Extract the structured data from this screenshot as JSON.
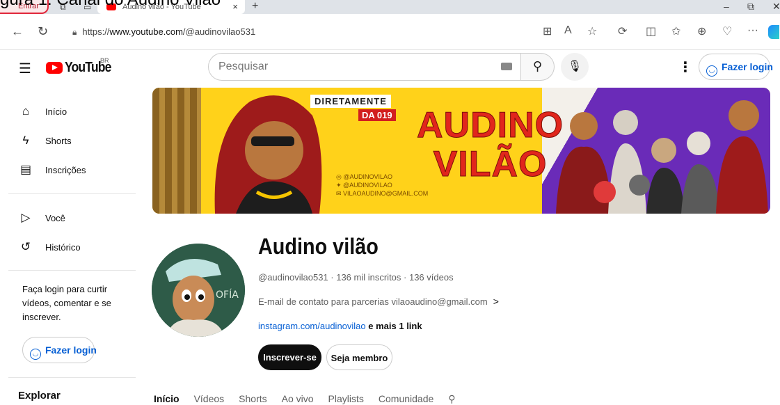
{
  "caption": "gura 1: Canal do Audino Vilão",
  "browser": {
    "profile_label": "Entrar",
    "tab_title": "Audino vilão - YouTube",
    "tab_close": "×",
    "new_tab": "+",
    "url_scheme": "https://",
    "url_host": "www.youtube.com",
    "url_path": "/@audinovilao531",
    "more": "···"
  },
  "header": {
    "logo_text": "YouTube",
    "country": "BR",
    "search_placeholder": "Pesquisar",
    "login_label": "Fazer login"
  },
  "sidebar": {
    "items": [
      {
        "label": "Início"
      },
      {
        "label": "Shorts"
      },
      {
        "label": "Inscrições"
      },
      {
        "label": "Você"
      },
      {
        "label": "Histórico"
      }
    ],
    "login_prompt": "Faça login para curtir vídeos, comentar e se inscrever.",
    "login_label": "Fazer login",
    "explore_heading": "Explorar"
  },
  "banner": {
    "tag1": "DIRETAMENTE",
    "tag2": "DA 019",
    "title_line1": "AUDINO",
    "title_line2": "VILÃO",
    "social1": "@AUDINOVILAO",
    "social2": "@AUDINOVILAO",
    "social3": "VILAOAUDINO@GMAIL.COM"
  },
  "channel": {
    "name": "Audino vilão",
    "meta": "@audinovilao531 · 136 mil inscritos · 136 vídeos",
    "contact": "E-mail de contato para parcerias vilaoaudino@gmail.com",
    "link": "instagram.com/audinovilao",
    "more_links": "e mais 1 link",
    "subscribe_label": "Inscrever-se",
    "member_label": "Seja membro",
    "avatar_sign": "OFÍA"
  },
  "tabs": [
    "Início",
    "Vídeos",
    "Shorts",
    "Ao vivo",
    "Playlists",
    "Comunidade"
  ]
}
